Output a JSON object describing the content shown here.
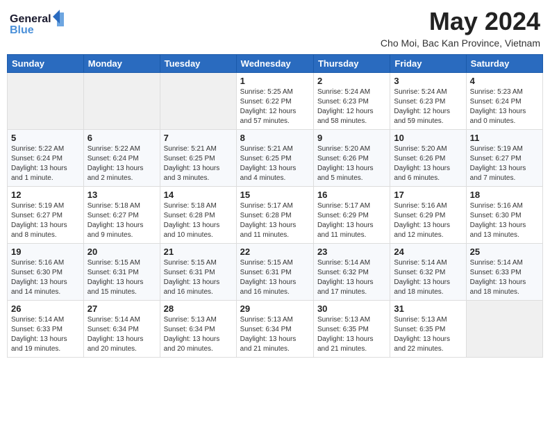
{
  "header": {
    "logo_general": "General",
    "logo_blue": "Blue",
    "month_title": "May 2024",
    "location": "Cho Moi, Bac Kan Province, Vietnam"
  },
  "days_of_week": [
    "Sunday",
    "Monday",
    "Tuesday",
    "Wednesday",
    "Thursday",
    "Friday",
    "Saturday"
  ],
  "weeks": [
    [
      {
        "day": "",
        "content": ""
      },
      {
        "day": "",
        "content": ""
      },
      {
        "day": "",
        "content": ""
      },
      {
        "day": "1",
        "content": "Sunrise: 5:25 AM\nSunset: 6:22 PM\nDaylight: 12 hours\nand 57 minutes."
      },
      {
        "day": "2",
        "content": "Sunrise: 5:24 AM\nSunset: 6:23 PM\nDaylight: 12 hours\nand 58 minutes."
      },
      {
        "day": "3",
        "content": "Sunrise: 5:24 AM\nSunset: 6:23 PM\nDaylight: 12 hours\nand 59 minutes."
      },
      {
        "day": "4",
        "content": "Sunrise: 5:23 AM\nSunset: 6:24 PM\nDaylight: 13 hours\nand 0 minutes."
      }
    ],
    [
      {
        "day": "5",
        "content": "Sunrise: 5:22 AM\nSunset: 6:24 PM\nDaylight: 13 hours\nand 1 minute."
      },
      {
        "day": "6",
        "content": "Sunrise: 5:22 AM\nSunset: 6:24 PM\nDaylight: 13 hours\nand 2 minutes."
      },
      {
        "day": "7",
        "content": "Sunrise: 5:21 AM\nSunset: 6:25 PM\nDaylight: 13 hours\nand 3 minutes."
      },
      {
        "day": "8",
        "content": "Sunrise: 5:21 AM\nSunset: 6:25 PM\nDaylight: 13 hours\nand 4 minutes."
      },
      {
        "day": "9",
        "content": "Sunrise: 5:20 AM\nSunset: 6:26 PM\nDaylight: 13 hours\nand 5 minutes."
      },
      {
        "day": "10",
        "content": "Sunrise: 5:20 AM\nSunset: 6:26 PM\nDaylight: 13 hours\nand 6 minutes."
      },
      {
        "day": "11",
        "content": "Sunrise: 5:19 AM\nSunset: 6:27 PM\nDaylight: 13 hours\nand 7 minutes."
      }
    ],
    [
      {
        "day": "12",
        "content": "Sunrise: 5:19 AM\nSunset: 6:27 PM\nDaylight: 13 hours\nand 8 minutes."
      },
      {
        "day": "13",
        "content": "Sunrise: 5:18 AM\nSunset: 6:27 PM\nDaylight: 13 hours\nand 9 minutes."
      },
      {
        "day": "14",
        "content": "Sunrise: 5:18 AM\nSunset: 6:28 PM\nDaylight: 13 hours\nand 10 minutes."
      },
      {
        "day": "15",
        "content": "Sunrise: 5:17 AM\nSunset: 6:28 PM\nDaylight: 13 hours\nand 11 minutes."
      },
      {
        "day": "16",
        "content": "Sunrise: 5:17 AM\nSunset: 6:29 PM\nDaylight: 13 hours\nand 11 minutes."
      },
      {
        "day": "17",
        "content": "Sunrise: 5:16 AM\nSunset: 6:29 PM\nDaylight: 13 hours\nand 12 minutes."
      },
      {
        "day": "18",
        "content": "Sunrise: 5:16 AM\nSunset: 6:30 PM\nDaylight: 13 hours\nand 13 minutes."
      }
    ],
    [
      {
        "day": "19",
        "content": "Sunrise: 5:16 AM\nSunset: 6:30 PM\nDaylight: 13 hours\nand 14 minutes."
      },
      {
        "day": "20",
        "content": "Sunrise: 5:15 AM\nSunset: 6:31 PM\nDaylight: 13 hours\nand 15 minutes."
      },
      {
        "day": "21",
        "content": "Sunrise: 5:15 AM\nSunset: 6:31 PM\nDaylight: 13 hours\nand 16 minutes."
      },
      {
        "day": "22",
        "content": "Sunrise: 5:15 AM\nSunset: 6:31 PM\nDaylight: 13 hours\nand 16 minutes."
      },
      {
        "day": "23",
        "content": "Sunrise: 5:14 AM\nSunset: 6:32 PM\nDaylight: 13 hours\nand 17 minutes."
      },
      {
        "day": "24",
        "content": "Sunrise: 5:14 AM\nSunset: 6:32 PM\nDaylight: 13 hours\nand 18 minutes."
      },
      {
        "day": "25",
        "content": "Sunrise: 5:14 AM\nSunset: 6:33 PM\nDaylight: 13 hours\nand 18 minutes."
      }
    ],
    [
      {
        "day": "26",
        "content": "Sunrise: 5:14 AM\nSunset: 6:33 PM\nDaylight: 13 hours\nand 19 minutes."
      },
      {
        "day": "27",
        "content": "Sunrise: 5:14 AM\nSunset: 6:34 PM\nDaylight: 13 hours\nand 20 minutes."
      },
      {
        "day": "28",
        "content": "Sunrise: 5:13 AM\nSunset: 6:34 PM\nDaylight: 13 hours\nand 20 minutes."
      },
      {
        "day": "29",
        "content": "Sunrise: 5:13 AM\nSunset: 6:34 PM\nDaylight: 13 hours\nand 21 minutes."
      },
      {
        "day": "30",
        "content": "Sunrise: 5:13 AM\nSunset: 6:35 PM\nDaylight: 13 hours\nand 21 minutes."
      },
      {
        "day": "31",
        "content": "Sunrise: 5:13 AM\nSunset: 6:35 PM\nDaylight: 13 hours\nand 22 minutes."
      },
      {
        "day": "",
        "content": ""
      }
    ]
  ]
}
